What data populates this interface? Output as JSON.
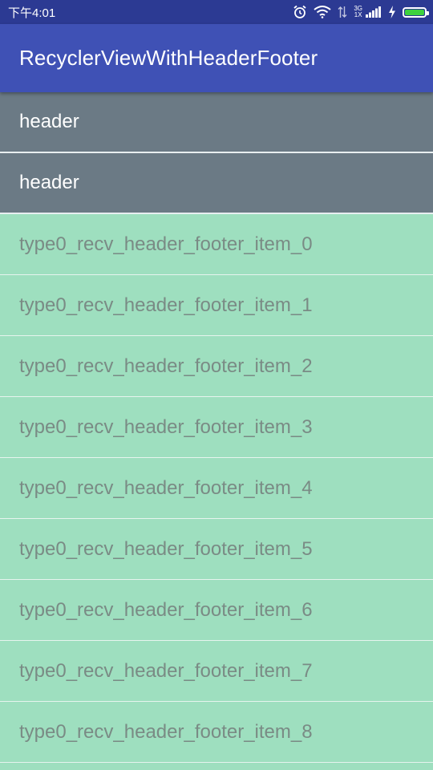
{
  "status_bar": {
    "time": "下午4:01",
    "network_top": "3G",
    "network_bottom": "1X",
    "icons": [
      "alarm-icon",
      "wifi-icon",
      "data-arrows-icon",
      "signal-icon",
      "charging-icon",
      "battery-icon"
    ],
    "battery_level": 1.0
  },
  "app_bar": {
    "title": "RecyclerViewWithHeaderFooter"
  },
  "list": {
    "headers": [
      {
        "label": "header"
      },
      {
        "label": "header"
      }
    ],
    "items": [
      {
        "label": "type0_recv_header_footer_item_0"
      },
      {
        "label": "type0_recv_header_footer_item_1"
      },
      {
        "label": "type0_recv_header_footer_item_2"
      },
      {
        "label": "type0_recv_header_footer_item_3"
      },
      {
        "label": "type0_recv_header_footer_item_4"
      },
      {
        "label": "type0_recv_header_footer_item_5"
      },
      {
        "label": "type0_recv_header_footer_item_6"
      },
      {
        "label": "type0_recv_header_footer_item_7"
      },
      {
        "label": "type0_recv_header_footer_item_8"
      }
    ]
  },
  "colors": {
    "status_bar": "#2c3a93",
    "app_bar": "#3f51b5",
    "header_bg": "#6b7a85",
    "item_bg": "#9edfbf",
    "item_text": "#7a8b85"
  }
}
